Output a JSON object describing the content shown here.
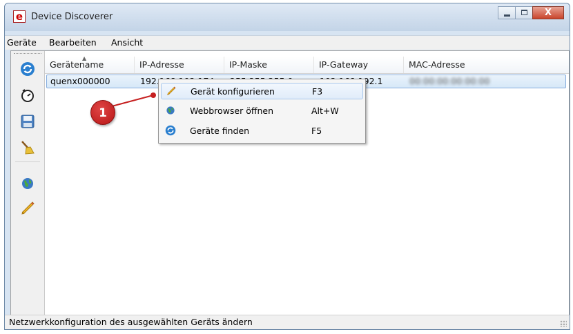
{
  "window": {
    "title": "Device Discoverer",
    "app_icon_letter": "e",
    "close_glyph": "X"
  },
  "menu": [
    "Geräte",
    "Bearbeiten",
    "Ansicht"
  ],
  "toolbar": {
    "icons": [
      "refresh-icon",
      "timer-icon",
      "save-icon",
      "broom-icon",
      "globe-icon",
      "pencil-icon"
    ]
  },
  "table": {
    "columns": [
      "Gerätename",
      "IP-Adresse",
      "IP-Maske",
      "IP-Gateway",
      "MAC-Adresse"
    ],
    "rows": [
      {
        "name": "quenx000000",
        "ip": "192.168.192.174",
        "mask": "255.255.255.0",
        "gateway": "192.168.192.1",
        "mac": "00:00:00:00:00:00"
      }
    ]
  },
  "context_menu": [
    {
      "label": "Gerät konfigurieren",
      "shortcut": "F3",
      "icon": "pencil-icon",
      "highlighted": true
    },
    {
      "label": "Webbrowser öffnen",
      "shortcut": "Alt+W",
      "icon": "globe-icon"
    },
    {
      "label": "Geräte finden",
      "shortcut": "F5",
      "icon": "refresh-icon"
    }
  ],
  "callout": {
    "number": "1",
    "color": "#c62020"
  },
  "status": "Netzwerkkonfiguration des ausgewählten Geräts ändern"
}
